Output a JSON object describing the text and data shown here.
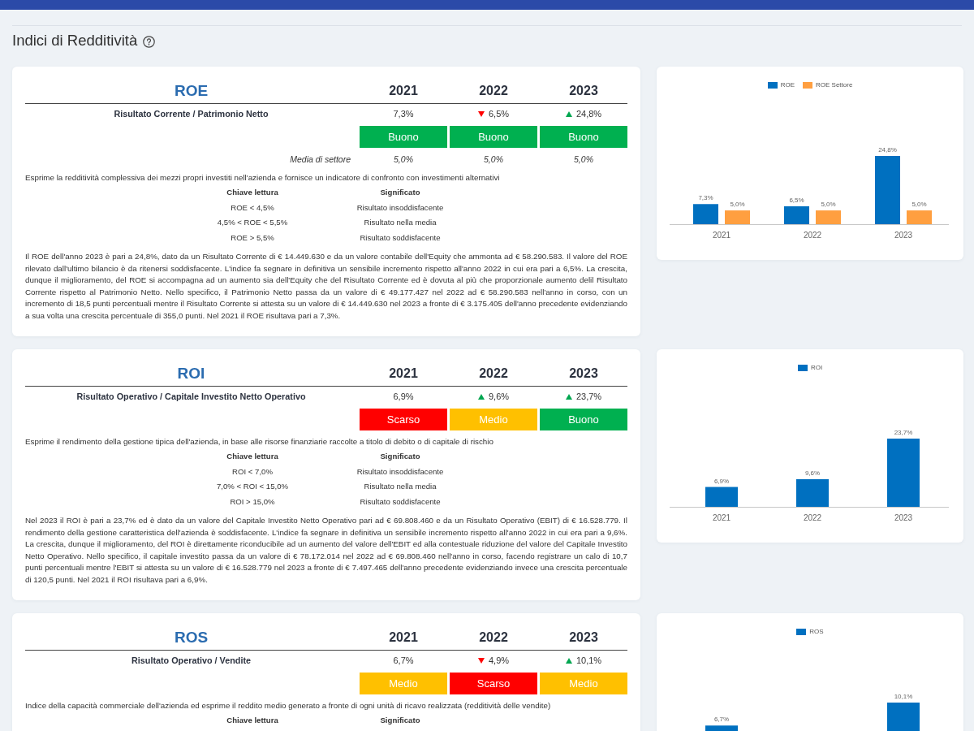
{
  "page": {
    "title": "Indici di Redditività"
  },
  "indices": [
    {
      "name": "ROE",
      "years": [
        "2021",
        "2022",
        "2023"
      ],
      "formula": "Risultato Corrente / Patrimonio Netto",
      "values": [
        {
          "kind": "plain",
          "text": "7,3%"
        },
        {
          "kind": "down",
          "text": "6,5%"
        },
        {
          "kind": "up",
          "text": "24,8%"
        }
      ],
      "ratings": [
        {
          "label": "Buono",
          "color": "#00b050"
        },
        {
          "label": "Buono",
          "color": "#00b050"
        },
        {
          "label": "Buono",
          "color": "#00b050"
        }
      ],
      "sector_average": {
        "label": "Media di settore",
        "values": [
          "5,0%",
          "5,0%",
          "5,0%"
        ]
      },
      "description": "Esprime la redditività complessiva dei mezzi propri investiti nell'azienda e fornisce un indicatore di confronto con investimenti alternativi",
      "key_table": {
        "columns": [
          "Chiave lettura",
          "Significato"
        ],
        "rows": [
          [
            "ROE < 4,5%",
            "Risultato insoddisfacente"
          ],
          [
            "4,5% < ROE < 5,5%",
            "Risultato nella media"
          ],
          [
            "ROE > 5,5%",
            "Risultato soddisfacente"
          ]
        ]
      },
      "commentary": "Il ROE dell'anno 2023 è pari a 24,8%, dato da un Risultato Corrente di € 14.449.630 e da un valore contabile dell'Equity che ammonta ad € 58.290.583. Il valore del ROE rilevato dall'ultimo bilancio è da ritenersi soddisfacente. L'indice fa segnare in definitiva un sensibile incremento rispetto all'anno 2022 in cui era pari a 6,5%. La crescita, dunque il miglioramento, del ROE si accompagna ad un aumento sia dell'Equity che del Risultato Corrente ed è dovuta al più che proporzionale aumento delil Risultato Corrente rispetto al Patrimonio Netto. Nello specifico, il Patrimonio Netto passa da un valore di € 49.177.427 nel 2022 ad € 58.290.583 nell'anno in corso, con un incremento di 18,5 punti percentuali mentre il Risultato Corrente si attesta su un valore di € 14.449.630 nel 2023 a fronte di € 3.175.405 dell'anno precedente evidenziando a sua volta una crescita percentuale di 355,0 punti. Nel 2021 il ROE risultava pari a 7,3%.",
      "chart_data": {
        "type": "bar",
        "legend": "top",
        "categories": [
          "2021",
          "2022",
          "2023"
        ],
        "series": [
          {
            "name": "ROE",
            "color": "#0070c0",
            "values": [
              7.3,
              6.5,
              24.8
            ],
            "value_labels": [
              "7,3%",
              "6,5%",
              "24,8%"
            ]
          },
          {
            "name": "ROE Settore",
            "color": "#ff9f40",
            "values": [
              5.0,
              5.0,
              5.0
            ],
            "value_labels": [
              "5,0%",
              "5,0%",
              "5,0%"
            ]
          }
        ]
      }
    },
    {
      "name": "ROI",
      "years": [
        "2021",
        "2022",
        "2023"
      ],
      "formula": "Risultato Operativo / Capitale Investito Netto Operativo",
      "values": [
        {
          "kind": "plain",
          "text": "6,9%"
        },
        {
          "kind": "up",
          "text": "9,6%"
        },
        {
          "kind": "up",
          "text": "23,7%"
        }
      ],
      "ratings": [
        {
          "label": "Scarso",
          "color": "#ff0000"
        },
        {
          "label": "Medio",
          "color": "#ffc000"
        },
        {
          "label": "Buono",
          "color": "#00b050"
        }
      ],
      "description": "Esprime il rendimento della gestione tipica dell'azienda, in base alle risorse finanziarie raccolte a titolo di debito o di capitale di rischio",
      "key_table": {
        "columns": [
          "Chiave lettura",
          "Significato"
        ],
        "rows": [
          [
            "ROI < 7,0%",
            "Risultato insoddisfacente"
          ],
          [
            "7,0% < ROI < 15,0%",
            "Risultato nella media"
          ],
          [
            "ROI > 15,0%",
            "Risultato soddisfacente"
          ]
        ]
      },
      "commentary": "Nel 2023 il ROI è pari a 23,7% ed è dato da un valore del Capitale Investito Netto Operativo pari ad € 69.808.460 e da un Risultato Operativo (EBIT) di € 16.528.779. Il rendimento della gestione caratteristica dell'azienda è soddisfacente. L'indice fa segnare in definitiva un sensibile incremento rispetto all'anno 2022 in cui era pari a 9,6%. La crescita, dunque il miglioramento, del ROI è direttamente riconducibile ad un aumento del valore dell'EBIT ed alla contestuale riduzione del valore del Capitale Investito Netto Operativo. Nello specifico, il capitale investito passa da un valore di € 78.172.014 nel 2022 ad € 69.808.460 nell'anno in corso, facendo registrare un calo di 10,7 punti percentuali mentre l'EBIT si attesta su un valore di € 16.528.779 nel 2023 a fronte di € 7.497.465 dell'anno precedente evidenziando invece una crescita percentuale di 120,5 punti. Nel 2021 il ROI risultava pari a 6,9%.",
      "chart_data": {
        "type": "bar",
        "legend": "top",
        "categories": [
          "2021",
          "2022",
          "2023"
        ],
        "series": [
          {
            "name": "ROI",
            "color": "#0070c0",
            "values": [
              6.9,
              9.6,
              23.7
            ],
            "value_labels": [
              "6,9%",
              "9,6%",
              "23,7%"
            ]
          }
        ]
      }
    },
    {
      "name": "ROS",
      "years": [
        "2021",
        "2022",
        "2023"
      ],
      "formula": "Risultato Operativo / Vendite",
      "values": [
        {
          "kind": "plain",
          "text": "6,7%"
        },
        {
          "kind": "down",
          "text": "4,9%"
        },
        {
          "kind": "up",
          "text": "10,1%"
        }
      ],
      "ratings": [
        {
          "label": "Medio",
          "color": "#ffc000"
        },
        {
          "label": "Scarso",
          "color": "#ff0000"
        },
        {
          "label": "Medio",
          "color": "#ffc000"
        }
      ],
      "description": "Indice della capacità commerciale dell'azienda ed esprime il reddito medio generato a fronte di ogni unità di ricavo realizzata (redditività delle vendite)",
      "key_table": {
        "columns": [
          "Chiave lettura",
          "Significato"
        ]
      },
      "chart_data": {
        "type": "bar",
        "legend": "top",
        "series": [
          {
            "name": "ROS",
            "color": "#0070c0",
            "values": [
              6.7,
              null,
              10.1
            ],
            "value_labels": [
              "6,7%",
              null,
              "10,1%"
            ]
          }
        ]
      }
    }
  ]
}
